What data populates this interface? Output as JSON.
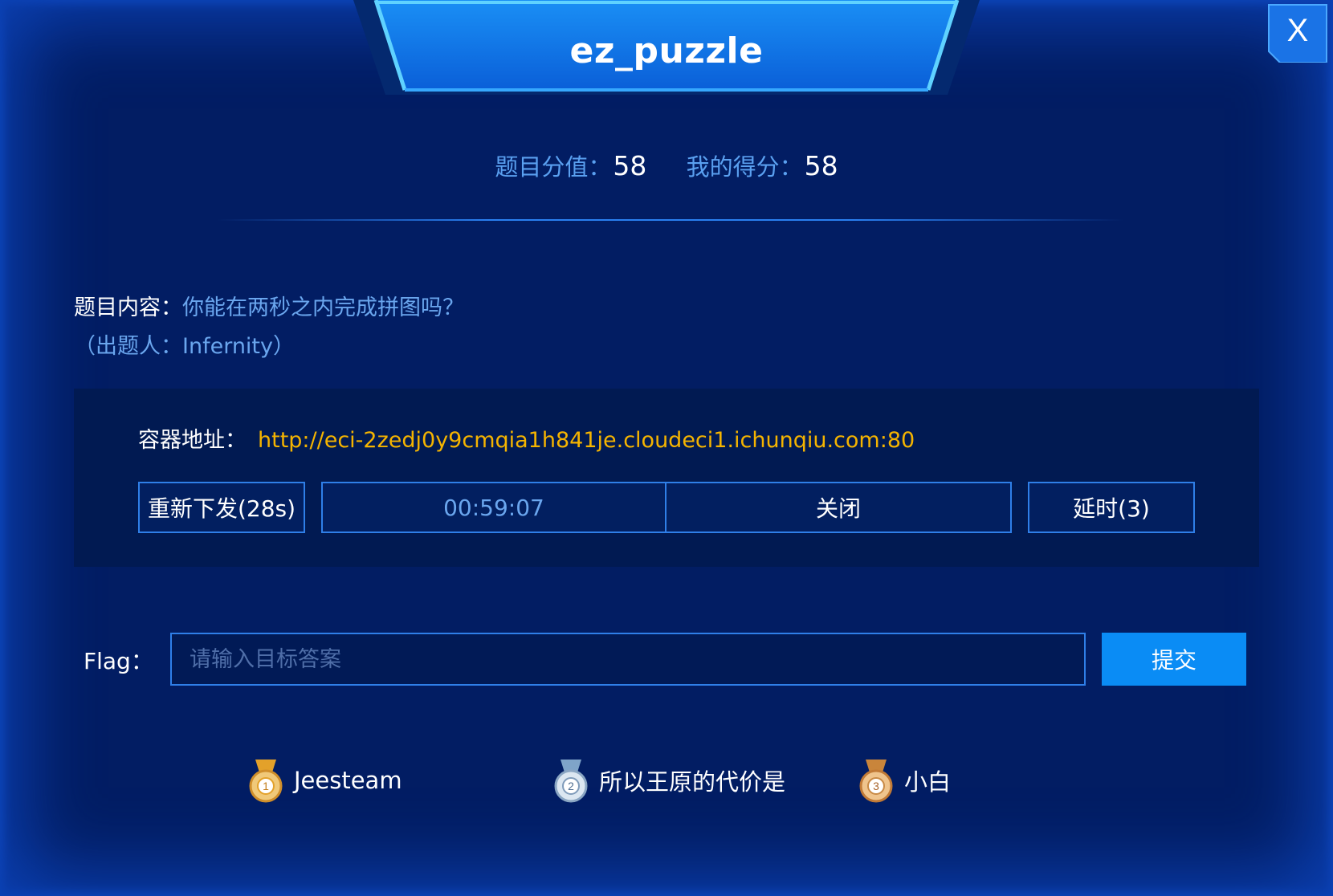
{
  "title": "ez_puzzle",
  "close_glyph": "X",
  "score": {
    "value_label": "题目分值：",
    "value": "58",
    "mine_label": "我的得分：",
    "mine": "58"
  },
  "description": {
    "label": "题目内容：",
    "text": "你能在两秒之内完成拼图吗？",
    "author": "（出题人：Infernity）"
  },
  "container": {
    "label": "容器地址：",
    "url": "http://eci-2zedj0y9cmqia1h841je.cloudeci1.ichunqiu.com:80",
    "resend_label": "重新下发(28s)",
    "timer": "00:59:07",
    "close_label": "关闭",
    "extend_label": "延时(3)"
  },
  "flag": {
    "label": "Flag：",
    "placeholder": "请输入目标答案",
    "value": "",
    "submit_label": "提交"
  },
  "ranking": [
    {
      "rank": "1",
      "name": "Jeesteam",
      "medal": "gold"
    },
    {
      "rank": "2",
      "name": "所以王原的代价是",
      "medal": "silver"
    },
    {
      "rank": "3",
      "name": "小白",
      "medal": "bronze"
    }
  ],
  "colors": {
    "background": "#021d63",
    "accent": "#0a8cf5",
    "border": "#2f7fe8",
    "url": "#f5b400",
    "label_blue": "#6aa6ee"
  }
}
